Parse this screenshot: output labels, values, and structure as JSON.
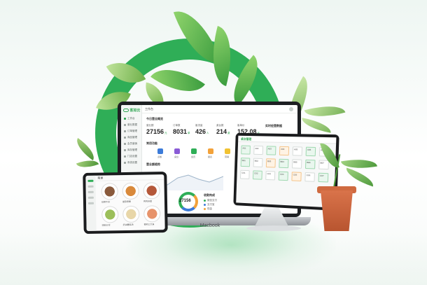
{
  "colors": {
    "brand": "#2fae57",
    "accent_orange": "#f3a23a",
    "accent_blue": "#3c7bd9",
    "pot": "#c96340"
  },
  "macbook": {
    "label": "Macbook",
    "dashboard": {
      "brand_name": "客如云",
      "page_title": "工作台",
      "sidebar": [
        {
          "label": "工作台",
          "icon": "home-icon"
        },
        {
          "label": "营业数据",
          "icon": "chart-icon"
        },
        {
          "label": "订单管理",
          "icon": "order-icon"
        },
        {
          "label": "商品管理",
          "icon": "goods-icon"
        },
        {
          "label": "会员营销",
          "icon": "member-icon"
        },
        {
          "label": "库存管理",
          "icon": "stock-icon"
        },
        {
          "label": "门店设置",
          "icon": "store-icon"
        },
        {
          "label": "系统设置",
          "icon": "gear-icon"
        }
      ],
      "summary_title": "今日营业概览",
      "stats": [
        {
          "label": "营业额",
          "value": "27156",
          "unit": "元"
        },
        {
          "label": "订单数",
          "value": "8031",
          "unit": "单"
        },
        {
          "label": "客流量",
          "value": "426",
          "unit": "人"
        },
        {
          "label": "桌台数",
          "value": "214",
          "unit": "桌"
        },
        {
          "label": "客单价",
          "value": "152.08",
          "unit": "元"
        }
      ],
      "quick_title": "常用功能",
      "quick_items": [
        {
          "label": "点餐",
          "color": "#3c7bd9"
        },
        {
          "label": "桌台",
          "color": "#8a5bd6"
        },
        {
          "label": "会员",
          "color": "#2fae57"
        },
        {
          "label": "报表",
          "color": "#f3a23a"
        },
        {
          "label": "营销",
          "color": "#f1c232"
        }
      ],
      "trend_title": "营业额趋势",
      "gauge_value": "27156",
      "gauge_title": "收款构成",
      "legend": [
        {
          "label": "微信支付",
          "color": "#2fae57"
        },
        {
          "label": "支付宝",
          "color": "#3c7bd9"
        },
        {
          "label": "现金",
          "color": "#f3a23a"
        }
      ],
      "right_panel_title": "实时经营数据"
    }
  },
  "tablet": {
    "title": "菜单",
    "dishes": [
      {
        "caption": "招牌牛排",
        "color": "#8a5a3c"
      },
      {
        "caption": "番茄意面",
        "color": "#d9893b"
      },
      {
        "caption": "烤肉拼盘",
        "color": "#b5583a"
      },
      {
        "caption": "田园沙拉",
        "color": "#9cbf5a"
      },
      {
        "caption": "奶油蘑菇汤",
        "color": "#e8d6a8"
      },
      {
        "caption": "香煎三文鱼",
        "color": "#e7936b"
      }
    ]
  },
  "pos": {
    "title": "桌台管理",
    "tiles": [
      {
        "label": "A01",
        "state": "busy"
      },
      {
        "label": "A02",
        "state": "free"
      },
      {
        "label": "A03",
        "state": "busy"
      },
      {
        "label": "A04",
        "state": "alert"
      },
      {
        "label": "A05",
        "state": "free"
      },
      {
        "label": "A06",
        "state": "busy"
      },
      {
        "label": "A07",
        "state": "free"
      },
      {
        "label": "B01",
        "state": "busy"
      },
      {
        "label": "B02",
        "state": "free"
      },
      {
        "label": "B03",
        "state": "alert"
      },
      {
        "label": "B04",
        "state": "busy"
      },
      {
        "label": "B05",
        "state": "free"
      },
      {
        "label": "B06",
        "state": "busy"
      },
      {
        "label": "B07",
        "state": "free"
      },
      {
        "label": "C01",
        "state": "free"
      },
      {
        "label": "C02",
        "state": "busy"
      },
      {
        "label": "C03",
        "state": "free"
      },
      {
        "label": "C04",
        "state": "busy"
      },
      {
        "label": "C05",
        "state": "alert"
      },
      {
        "label": "C06",
        "state": "free"
      },
      {
        "label": "C07",
        "state": "busy"
      }
    ]
  }
}
